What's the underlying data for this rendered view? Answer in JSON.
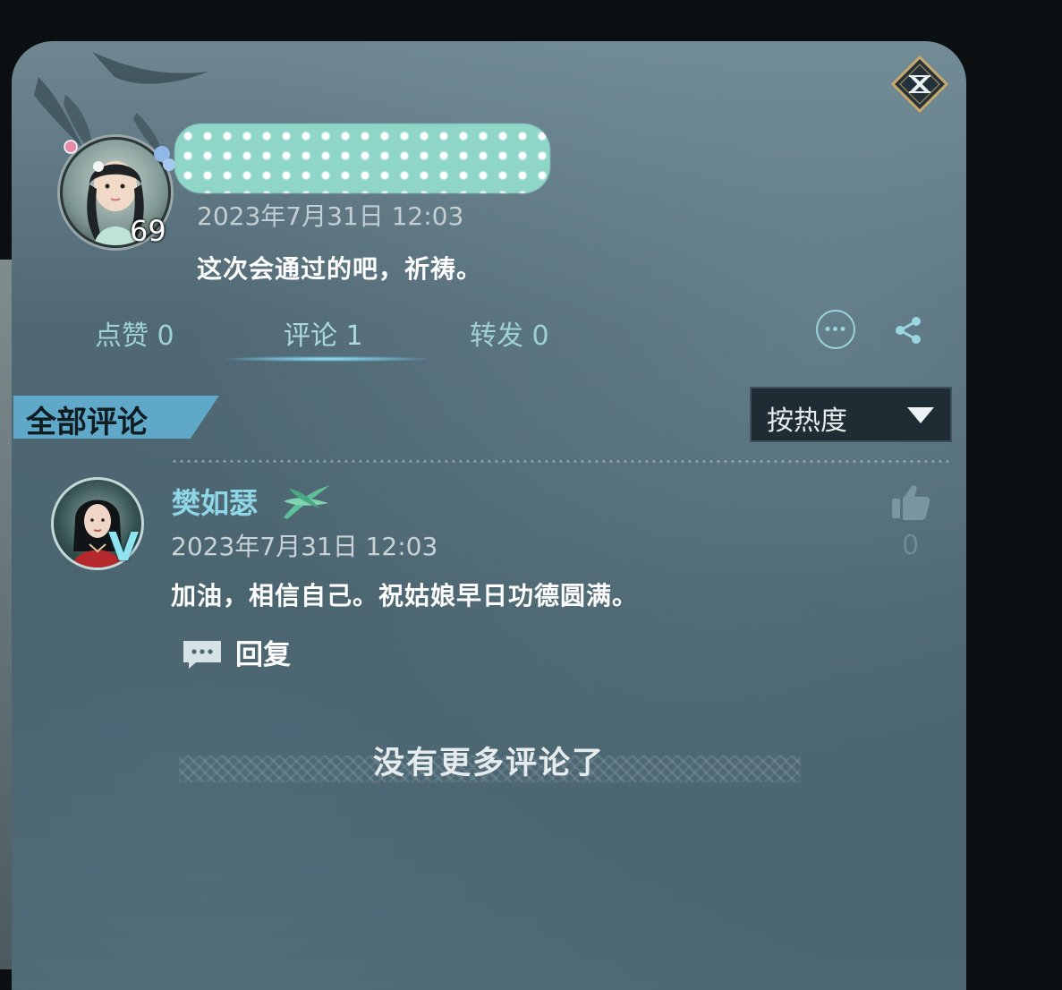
{
  "post": {
    "level": "69",
    "time": "2023年7月31日 12:03",
    "text": "这次会通过的吧，祈祷。"
  },
  "tabs": [
    {
      "label": "点赞 0",
      "active": false
    },
    {
      "label": "评论 1",
      "active": true
    },
    {
      "label": "转发 0",
      "active": false
    }
  ],
  "comments_section": {
    "label": "全部评论",
    "sort_label": "按热度"
  },
  "comment": {
    "name": "樊如瑟",
    "time": "2023年7月31日 12:03",
    "text": "加油，相信自己。祝姑娘早日功德圆满。",
    "reply_label": "回复",
    "like_count": "0",
    "verified_mark": "V"
  },
  "end_text": "没有更多评论了",
  "colors": {
    "accent": "#9fd1d4",
    "section_tag": "#5fa8c8",
    "name": "#8fd7e6"
  }
}
